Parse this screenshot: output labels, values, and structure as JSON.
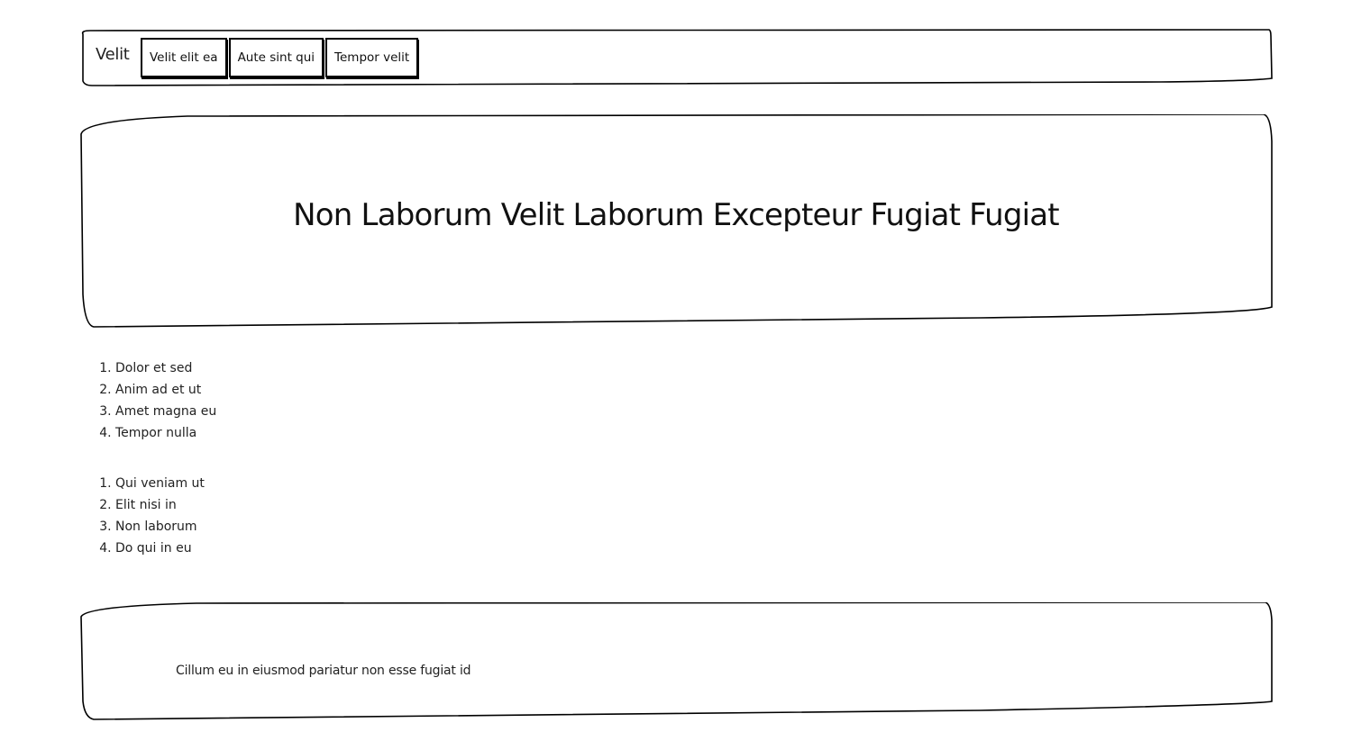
{
  "navbar": {
    "brand": "Velit",
    "links": [
      {
        "label": "Velit elit ea"
      },
      {
        "label": "Aute sint qui"
      },
      {
        "label": "Tempor velit"
      }
    ]
  },
  "hero": {
    "title": "Non Laborum Velit Laborum Excepteur Fugiat Fugiat"
  },
  "lists": [
    {
      "items": [
        "Dolor et sed",
        "Anim ad et ut",
        "Amet magna eu",
        "Tempor nulla"
      ]
    },
    {
      "items": [
        "Qui veniam ut",
        "Elit nisi in",
        "Non laborum",
        "Do qui in eu"
      ]
    }
  ],
  "footer": {
    "text": "Cillum eu in eiusmod pariatur non esse fugiat id"
  }
}
